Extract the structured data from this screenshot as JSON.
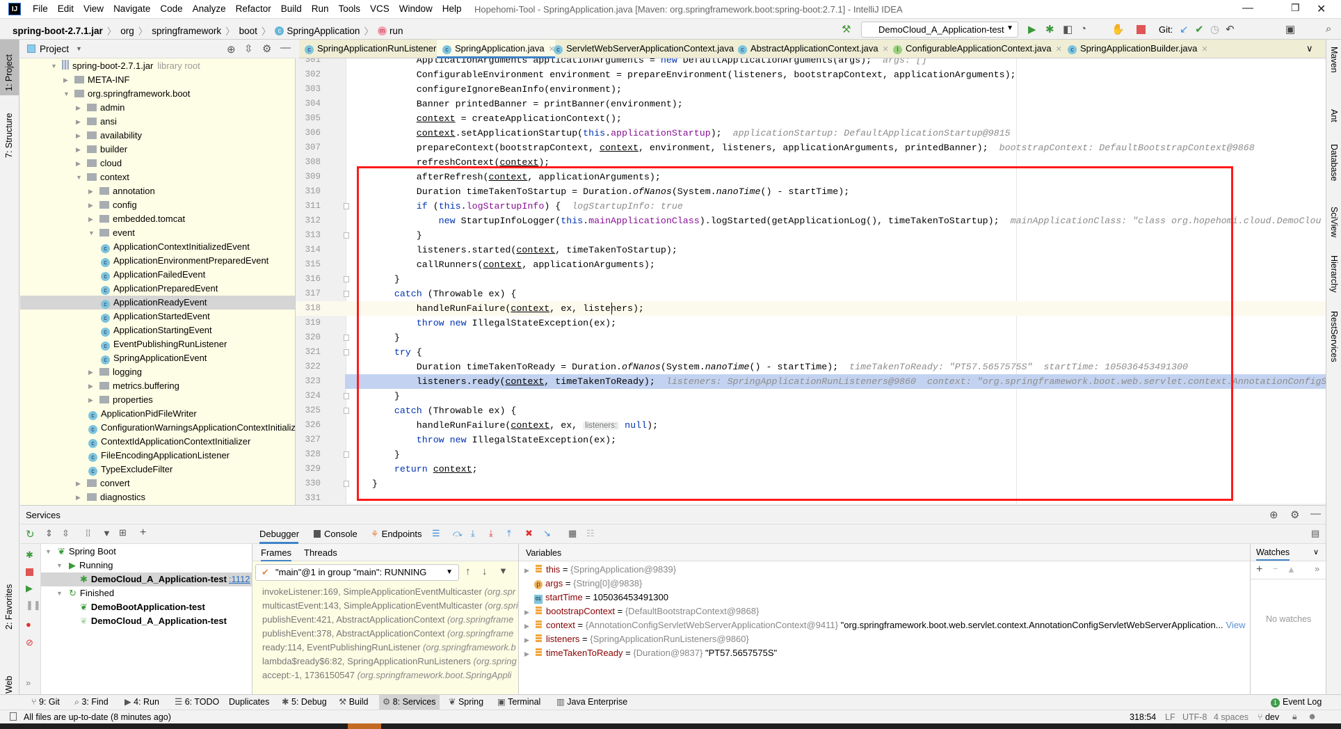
{
  "window": {
    "title": "Hopehomi-Tool - SpringApplication.java [Maven: org.springframework.boot:spring-boot:2.7.1] - IntelliJ IDEA",
    "logo": "IJ"
  },
  "menu": [
    "File",
    "Edit",
    "View",
    "Navigate",
    "Code",
    "Analyze",
    "Refactor",
    "Build",
    "Run",
    "Tools",
    "VCS",
    "Window",
    "Help"
  ],
  "breadcrumb": [
    "spring-boot-2.7.1.jar",
    "org",
    "springframework",
    "boot",
    "SpringApplication",
    "run"
  ],
  "toolbar": {
    "run_config": "DemoCloud_A_Application-test",
    "git_label": "Git:"
  },
  "left_strip": [
    "1: Project",
    "7: Structure",
    "2: Favorites",
    "Web"
  ],
  "right_strip": [
    "Maven",
    "Ant",
    "Database",
    "SciView",
    "Hierarchy",
    "RestServices"
  ],
  "project": {
    "title": "Project",
    "library_root": "library root",
    "tree": [
      {
        "label": "spring-boot-2.7.1.jar",
        "level": 0,
        "type": "jar",
        "open": true
      },
      {
        "label": "META-INF",
        "level": 1,
        "type": "folder",
        "open": false
      },
      {
        "label": "org.springframework.boot",
        "level": 1,
        "type": "folder",
        "open": true
      },
      {
        "label": "admin",
        "level": 2,
        "type": "folder",
        "open": false
      },
      {
        "label": "ansi",
        "level": 2,
        "type": "folder",
        "open": false
      },
      {
        "label": "availability",
        "level": 2,
        "type": "folder",
        "open": false
      },
      {
        "label": "builder",
        "level": 2,
        "type": "folder",
        "open": false
      },
      {
        "label": "cloud",
        "level": 2,
        "type": "folder",
        "open": false
      },
      {
        "label": "context",
        "level": 2,
        "type": "folder",
        "open": true
      },
      {
        "label": "annotation",
        "level": 3,
        "type": "folder",
        "open": false
      },
      {
        "label": "config",
        "level": 3,
        "type": "folder",
        "open": false
      },
      {
        "label": "embedded.tomcat",
        "level": 3,
        "type": "folder",
        "open": false
      },
      {
        "label": "event",
        "level": 3,
        "type": "folder",
        "open": true
      },
      {
        "label": "ApplicationContextInitializedEvent",
        "level": 4,
        "type": "class"
      },
      {
        "label": "ApplicationEnvironmentPreparedEvent",
        "level": 4,
        "type": "class"
      },
      {
        "label": "ApplicationFailedEvent",
        "level": 4,
        "type": "class"
      },
      {
        "label": "ApplicationPreparedEvent",
        "level": 4,
        "type": "class"
      },
      {
        "label": "ApplicationReadyEvent",
        "level": 4,
        "type": "class",
        "selected": true
      },
      {
        "label": "ApplicationStartedEvent",
        "level": 4,
        "type": "class"
      },
      {
        "label": "ApplicationStartingEvent",
        "level": 4,
        "type": "class"
      },
      {
        "label": "EventPublishingRunListener",
        "level": 4,
        "type": "class"
      },
      {
        "label": "SpringApplicationEvent",
        "level": 4,
        "type": "class"
      },
      {
        "label": "logging",
        "level": 3,
        "type": "folder",
        "open": false
      },
      {
        "label": "metrics.buffering",
        "level": 3,
        "type": "folder",
        "open": false
      },
      {
        "label": "properties",
        "level": 3,
        "type": "folder",
        "open": false
      },
      {
        "label": "ApplicationPidFileWriter",
        "level": 3,
        "type": "class"
      },
      {
        "label": "ConfigurationWarningsApplicationContextInitializer",
        "level": 3,
        "type": "class"
      },
      {
        "label": "ContextIdApplicationContextInitializer",
        "level": 3,
        "type": "class"
      },
      {
        "label": "FileEncodingApplicationListener",
        "level": 3,
        "type": "class"
      },
      {
        "label": "TypeExcludeFilter",
        "level": 3,
        "type": "class"
      },
      {
        "label": "convert",
        "level": 2,
        "type": "folder",
        "open": false
      },
      {
        "label": "diagnostics",
        "level": 2,
        "type": "folder",
        "open": false
      }
    ]
  },
  "editor_tabs": [
    {
      "label": "SpringApplicationRunListeners.java",
      "icon": "C"
    },
    {
      "label": "SpringApplication.java",
      "icon": "C",
      "active": true
    },
    {
      "label": "ServletWebServerApplicationContext.java",
      "icon": "C"
    },
    {
      "label": "AbstractApplicationContext.java",
      "icon": "C"
    },
    {
      "label": "ConfigurableApplicationContext.java",
      "icon": "I"
    },
    {
      "label": "SpringApplicationBuilder.java",
      "icon": "C"
    }
  ],
  "code": {
    "caret_line": "318",
    "exec_line": "323",
    "lines": [
      {
        "n": "301",
        "tokens": [
          {
            "t": "            ApplicationArguments applicationArguments = "
          },
          {
            "t": "new",
            "c": "k"
          },
          {
            "t": " DefaultApplicationArguments(args);"
          },
          {
            "t": "  args: []",
            "c": "h"
          }
        ]
      },
      {
        "n": "302",
        "tokens": [
          {
            "t": "            ConfigurableEnvironment environment = prepareEnvironment(listeners, bootstrapContext, applicationArguments);"
          }
        ]
      },
      {
        "n": "303",
        "tokens": [
          {
            "t": "            configureIgnoreBeanInfo(environment);"
          }
        ]
      },
      {
        "n": "304",
        "tokens": [
          {
            "t": "            Banner printedBanner = printBanner(environment);"
          }
        ]
      },
      {
        "n": "305",
        "tokens": [
          {
            "t": "            "
          },
          {
            "t": "context",
            "c": "u"
          },
          {
            "t": " = createApplicationContext();"
          }
        ]
      },
      {
        "n": "306",
        "tokens": [
          {
            "t": "            "
          },
          {
            "t": "context",
            "c": "u"
          },
          {
            "t": ".setApplicationStartup("
          },
          {
            "t": "this",
            "c": "k"
          },
          {
            "t": "."
          },
          {
            "t": "applicationStartup",
            "c": "f"
          },
          {
            "t": ");"
          },
          {
            "t": "  applicationStartup: DefaultApplicationStartup@9815",
            "c": "h"
          }
        ]
      },
      {
        "n": "307",
        "tokens": [
          {
            "t": "            prepareContext(bootstrapContext, "
          },
          {
            "t": "context",
            "c": "u"
          },
          {
            "t": ", environment, listeners, applicationArguments, printedBanner);"
          },
          {
            "t": "  bootstrapContext: DefaultBootstrapContext@9868",
            "c": "h"
          }
        ]
      },
      {
        "n": "308",
        "tokens": [
          {
            "t": "            refreshContext("
          },
          {
            "t": "context",
            "c": "u"
          },
          {
            "t": ");"
          }
        ]
      },
      {
        "n": "309",
        "tokens": [
          {
            "t": "            afterRefresh("
          },
          {
            "t": "context",
            "c": "u"
          },
          {
            "t": ", applicationArguments);"
          }
        ]
      },
      {
        "n": "310",
        "tokens": [
          {
            "t": "            Duration timeTakenToStartup = Duration."
          },
          {
            "t": "ofNanos",
            "c": "i"
          },
          {
            "t": "(System."
          },
          {
            "t": "nanoTime",
            "c": "i"
          },
          {
            "t": "() - startTime);"
          }
        ]
      },
      {
        "n": "311",
        "fold": true,
        "tokens": [
          {
            "t": "            "
          },
          {
            "t": "if",
            "c": "k"
          },
          {
            "t": " ("
          },
          {
            "t": "this",
            "c": "k"
          },
          {
            "t": "."
          },
          {
            "t": "logStartupInfo",
            "c": "f"
          },
          {
            "t": ") {"
          },
          {
            "t": "  logStartupInfo: true",
            "c": "h"
          }
        ]
      },
      {
        "n": "312",
        "tokens": [
          {
            "t": "                "
          },
          {
            "t": "new",
            "c": "k"
          },
          {
            "t": " StartupInfoLogger("
          },
          {
            "t": "this",
            "c": "k"
          },
          {
            "t": "."
          },
          {
            "t": "mainApplicationClass",
            "c": "f"
          },
          {
            "t": ").logStarted(getApplicationLog(), timeTakenToStartup);"
          },
          {
            "t": "  mainApplicationClass: \"class org.hopehomi.cloud.DemoClou",
            "c": "h"
          }
        ]
      },
      {
        "n": "313",
        "fold": true,
        "tokens": [
          {
            "t": "            }"
          }
        ]
      },
      {
        "n": "314",
        "tokens": [
          {
            "t": "            listeners.started("
          },
          {
            "t": "context",
            "c": "u"
          },
          {
            "t": ", timeTakenToStartup);"
          }
        ]
      },
      {
        "n": "315",
        "tokens": [
          {
            "t": "            callRunners("
          },
          {
            "t": "context",
            "c": "u"
          },
          {
            "t": ", applicationArguments);"
          }
        ]
      },
      {
        "n": "316",
        "fold": true,
        "tokens": [
          {
            "t": "        }"
          }
        ]
      },
      {
        "n": "317",
        "fold": true,
        "tokens": [
          {
            "t": "        "
          },
          {
            "t": "catch",
            "c": "k"
          },
          {
            "t": " (Throwable ex) {"
          }
        ]
      },
      {
        "n": "318",
        "tokens": [
          {
            "t": "            handleRunFailure("
          },
          {
            "t": "context",
            "c": "u"
          },
          {
            "t": ", ex, listeners);"
          }
        ]
      },
      {
        "n": "319",
        "tokens": [
          {
            "t": "            "
          },
          {
            "t": "throw",
            "c": "k"
          },
          {
            "t": " "
          },
          {
            "t": "new",
            "c": "k"
          },
          {
            "t": " IllegalStateException(ex);"
          }
        ]
      },
      {
        "n": "320",
        "fold": true,
        "tokens": [
          {
            "t": "        }"
          }
        ]
      },
      {
        "n": "321",
        "fold": true,
        "tokens": [
          {
            "t": "        "
          },
          {
            "t": "try",
            "c": "k"
          },
          {
            "t": " {"
          }
        ]
      },
      {
        "n": "322",
        "tokens": [
          {
            "t": "            Duration timeTakenToReady = Duration."
          },
          {
            "t": "ofNanos",
            "c": "i"
          },
          {
            "t": "(System."
          },
          {
            "t": "nanoTime",
            "c": "i"
          },
          {
            "t": "() - startTime);"
          },
          {
            "t": "  timeTakenToReady: \"PT57.5657575S\"  startTime: 105036453491300",
            "c": "h"
          }
        ]
      },
      {
        "n": "323",
        "tokens": [
          {
            "t": "            listeners.ready("
          },
          {
            "t": "context",
            "c": "u"
          },
          {
            "t": ", timeTakenToReady);"
          },
          {
            "t": "  listeners: SpringApplicationRunListeners@9860  context: \"org.springframework.boot.web.servlet.context.AnnotationConfigS",
            "c": "h"
          }
        ]
      },
      {
        "n": "324",
        "fold": true,
        "tokens": [
          {
            "t": "        }"
          }
        ]
      },
      {
        "n": "325",
        "fold": true,
        "tokens": [
          {
            "t": "        "
          },
          {
            "t": "catch",
            "c": "k"
          },
          {
            "t": " (Throwable ex) {"
          }
        ]
      },
      {
        "n": "326",
        "tokens": [
          {
            "t": "            handleRunFailure("
          },
          {
            "t": "context",
            "c": "u"
          },
          {
            "t": ", ex, "
          },
          {
            "t": "listeners:",
            "c": "p"
          },
          {
            "t": " "
          },
          {
            "t": "null",
            "c": "k"
          },
          {
            "t": ");"
          }
        ]
      },
      {
        "n": "327",
        "tokens": [
          {
            "t": "            "
          },
          {
            "t": "throw",
            "c": "k"
          },
          {
            "t": " "
          },
          {
            "t": "new",
            "c": "k"
          },
          {
            "t": " IllegalStateException(ex);"
          }
        ]
      },
      {
        "n": "328",
        "fold": true,
        "tokens": [
          {
            "t": "        }"
          }
        ]
      },
      {
        "n": "329",
        "tokens": [
          {
            "t": "        "
          },
          {
            "t": "return",
            "c": "k"
          },
          {
            "t": " "
          },
          {
            "t": "context",
            "c": "u"
          },
          {
            "t": ";"
          }
        ]
      },
      {
        "n": "330",
        "fold": true,
        "tokens": [
          {
            "t": "    }"
          }
        ]
      },
      {
        "n": "331",
        "tokens": [
          {
            "t": ""
          }
        ]
      }
    ]
  },
  "services": {
    "title": "Services",
    "tree": [
      {
        "label": "Spring Boot",
        "level": 0,
        "bold": false
      },
      {
        "label": "Running",
        "level": 1,
        "bold": false
      },
      {
        "label": "DemoCloud_A_Application-test",
        "level": 2,
        "bold": true,
        "port": ":1112",
        "selected": true
      },
      {
        "label": "Finished",
        "level": 1,
        "bold": false
      },
      {
        "label": "DemoBootApplication-test",
        "level": 2,
        "bold": true
      },
      {
        "label": "DemoCloud_A_Application-test",
        "level": 2,
        "bold": true
      }
    ]
  },
  "debugger": {
    "tabs": [
      "Debugger",
      "Console",
      "Endpoints"
    ],
    "frames_tab": "Frames",
    "threads_tab": "Threads",
    "thread": "\"main\"@1 in group \"main\": RUNNING",
    "frames": [
      {
        "m": "invokeListener:169, SimpleApplicationEventMulticaster",
        "p": "(org.spr"
      },
      {
        "m": "multicastEvent:143, SimpleApplicationEventMulticaster",
        "p": "(org.spri"
      },
      {
        "m": "publishEvent:421, AbstractApplicationContext",
        "p": "(org.springframe"
      },
      {
        "m": "publishEvent:378, AbstractApplicationContext",
        "p": "(org.springframe"
      },
      {
        "m": "ready:114, EventPublishingRunListener",
        "p": "(org.springframework.b"
      },
      {
        "m": "lambda$ready$6:82, SpringApplicationRunListeners",
        "p": "(org.spring"
      },
      {
        "m": "accept:-1, 1736150547",
        "p": "(org.springframework.boot.SpringAppli"
      }
    ],
    "variables_title": "Variables",
    "variables": [
      {
        "name": "this",
        "value": "{SpringApplication@9839}",
        "str": "",
        "icon": "field",
        "expand": true
      },
      {
        "name": "args",
        "value": "{String[0]@9838}",
        "str": "",
        "icon": "param",
        "expand": false
      },
      {
        "name": "startTime",
        "value": "",
        "str": "105036453491300",
        "icon": "primitive",
        "expand": false
      },
      {
        "name": "bootstrapContext",
        "value": "{DefaultBootstrapContext@9868}",
        "str": "",
        "icon": "field",
        "expand": true
      },
      {
        "name": "context",
        "value": "{AnnotationConfigServletWebServerApplicationContext@9411}",
        "str": "\"org.springframework.boot.web.servlet.context.AnnotationConfigServletWebServerApplication...",
        "link": "View",
        "icon": "field",
        "expand": true
      },
      {
        "name": "listeners",
        "value": "{SpringApplicationRunListeners@9860}",
        "str": "",
        "icon": "field",
        "expand": true
      },
      {
        "name": "timeTakenToReady",
        "value": "{Duration@9837}",
        "str": "\"PT57.5657575S\"",
        "icon": "field",
        "expand": true
      }
    ],
    "watches_title": "Watches",
    "no_watches": "No watches"
  },
  "bottom_tools": [
    {
      "label": "9: Git",
      "icon": "git"
    },
    {
      "label": "3: Find",
      "icon": "search"
    },
    {
      "label": "4: Run",
      "icon": "run"
    },
    {
      "label": "6: TODO",
      "icon": "list"
    },
    {
      "label": "Duplicates",
      "icon": ""
    },
    {
      "label": "5: Debug",
      "icon": "bug"
    },
    {
      "label": "Build",
      "icon": "hammer"
    },
    {
      "label": "8: Services",
      "icon": "services",
      "active": true
    },
    {
      "label": "Spring",
      "icon": "leaf"
    },
    {
      "label": "Terminal",
      "icon": "terminal"
    },
    {
      "label": "Java Enterprise",
      "icon": "javaee"
    }
  ],
  "event_log": {
    "label": "Event Log",
    "count": "1"
  },
  "status": {
    "message": "All files are up-to-date (8 minutes ago)",
    "position": "318:54",
    "line_sep": "LF",
    "encoding": "UTF-8",
    "indent": "4 spaces",
    "branch": "dev"
  },
  "colors": {
    "accent": "#4083c9",
    "highlight_box": "#ff1a1a",
    "exec_line": "#c3d2f0",
    "keyword": "#0033b3",
    "field": "#871094"
  }
}
